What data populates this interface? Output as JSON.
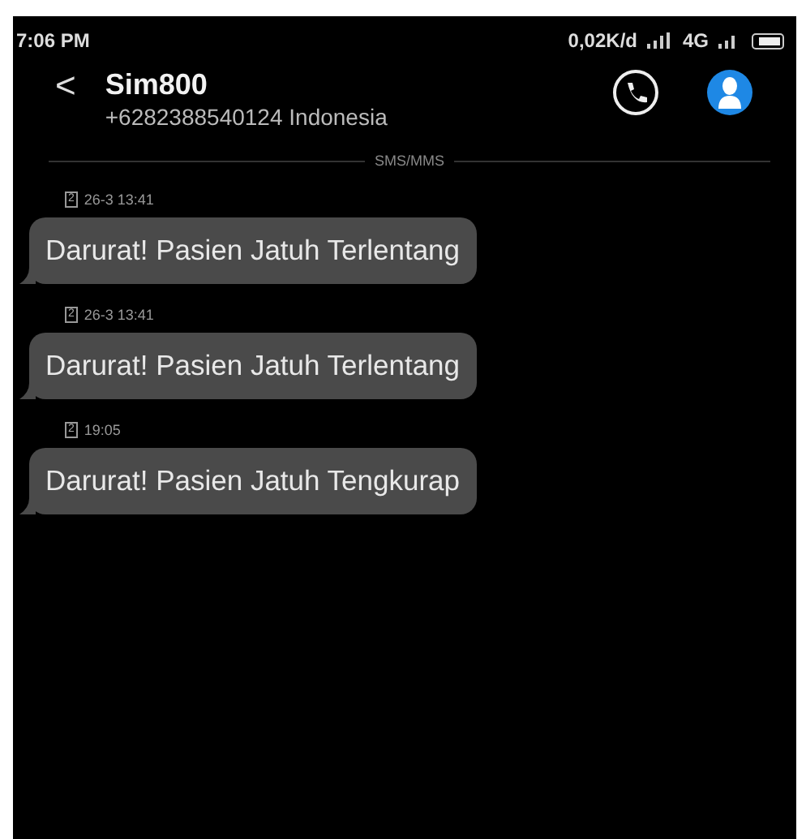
{
  "status_bar": {
    "time": "7:06 PM",
    "speed": "0,02K/d",
    "network": "4G"
  },
  "header": {
    "back": "<",
    "name": "Sim800",
    "number": "+6282388540124 Indonesia"
  },
  "divider_label": "SMS/MMS",
  "messages": [
    {
      "sim": "2",
      "time": "26-3 13:41",
      "text": "Darurat! Pasien Jatuh Terlentang"
    },
    {
      "sim": "2",
      "time": "26-3 13:41",
      "text": "Darurat! Pasien Jatuh Terlentang"
    },
    {
      "sim": "2",
      "time": "19:05",
      "text": "Darurat! Pasien Jatuh Tengkurap"
    }
  ]
}
